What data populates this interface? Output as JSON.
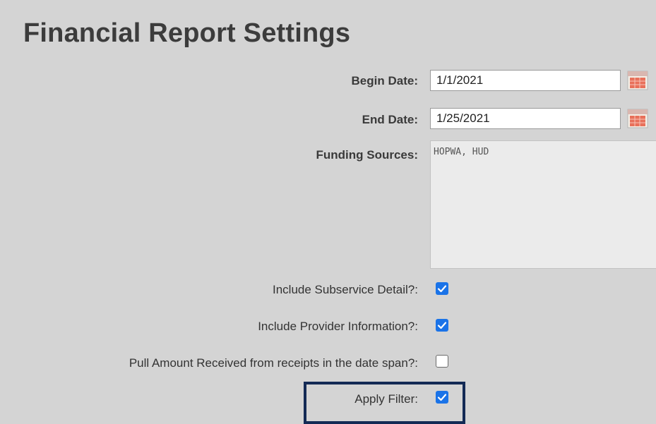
{
  "page": {
    "title": "Financial Report Settings"
  },
  "form": {
    "begin_date": {
      "label": "Begin Date:",
      "value": "1/1/2021",
      "icon": "calendar-icon"
    },
    "end_date": {
      "label": "End Date:",
      "value": "1/25/2021",
      "icon": "calendar-icon"
    },
    "funding_sources": {
      "label": "Funding Sources:",
      "value": "HOPWA, HUD"
    },
    "include_subservice_detail": {
      "label": "Include Subservice Detail?:",
      "checked": true
    },
    "include_provider_information": {
      "label": "Include Provider Information?:",
      "checked": true
    },
    "pull_amount_received": {
      "label": "Pull Amount Received from receipts in the date span?:",
      "checked": false
    },
    "apply_filter": {
      "label": "Apply Filter:",
      "checked": true
    }
  },
  "colors": {
    "checkbox_checked": "#1a73e8",
    "highlight_border": "#132a55",
    "background": "#d4d4d4"
  }
}
